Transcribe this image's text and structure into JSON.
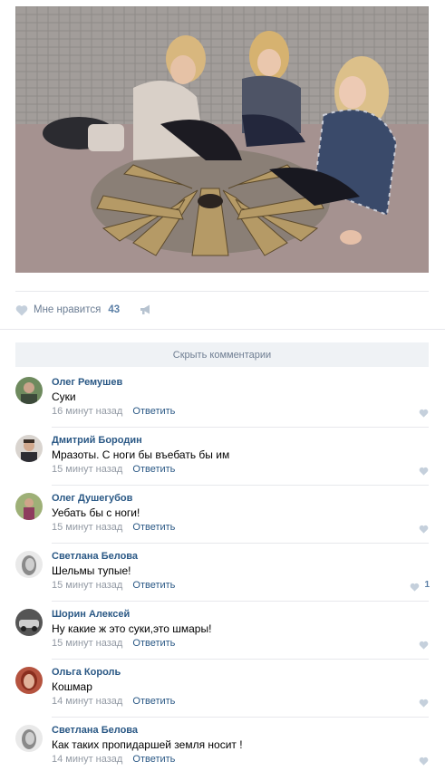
{
  "post": {
    "photo_icon": "photo-image",
    "likes": {
      "label": "Мне нравится",
      "count": "43",
      "icon": "heart-icon",
      "share_icon": "megaphone-icon"
    }
  },
  "comments_section": {
    "hide_label": "Скрыть комментарии",
    "reply_label": "Ответить",
    "items": [
      {
        "author": "Олег Ремушев",
        "text": "Суки",
        "time": "16 минут назад",
        "likes": ""
      },
      {
        "author": "Дмитрий Бородин",
        "text": "Мразоты. С ноги бы въебать бы им",
        "time": "15 минут назад",
        "likes": ""
      },
      {
        "author": "Олег Душегубов",
        "text": "Уебать бы с ноги!",
        "time": "15 минут назад",
        "likes": ""
      },
      {
        "author": "Светлана Белова",
        "text": "Шельмы тупые!",
        "time": "15 минут назад",
        "likes": "1"
      },
      {
        "author": "Шорин Алексей",
        "text": "Ну какие ж это суки,это шмары!",
        "time": "15 минут назад",
        "likes": ""
      },
      {
        "author": "Ольга Король",
        "text": "Кошмар",
        "time": "14 минут назад",
        "likes": ""
      },
      {
        "author": "Светлана Белова",
        "text": "Как таких пропидаршей земля носит !",
        "time": "14 минут назад",
        "likes": ""
      }
    ]
  },
  "colors": {
    "link": "#2a5885",
    "muted": "#939aa4",
    "heart": "#c5d0dc"
  }
}
